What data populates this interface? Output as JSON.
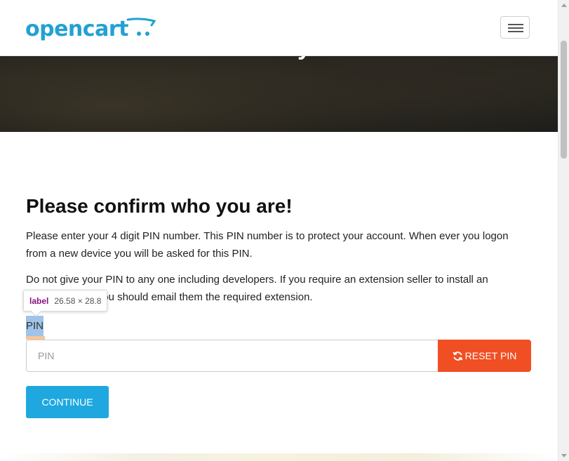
{
  "brand": {
    "logo_text": "opencart",
    "accent_color": "#23a1d1"
  },
  "navbar": {
    "menu_icon": "hamburger-icon"
  },
  "hero": {
    "title": "PIN Security Check"
  },
  "main": {
    "heading": "Please confirm who you are!",
    "paragraph_1": "Please enter your 4 digit PIN number. This PIN number is to protect your account. When ever you logon from a new device you will be asked for this PIN.",
    "paragraph_2": "Do not give your PIN to any one including developers. If you require an extension seller to install an extension then you should email them the required extension."
  },
  "form": {
    "pin_label": "PIN",
    "pin_placeholder": "PIN",
    "pin_value": "",
    "reset_button_label": "RESET PIN",
    "reset_button_icon": "refresh-icon",
    "reset_button_color": "#f04e23",
    "continue_button_label": "CONTINUE",
    "continue_button_color": "#1fa8e0"
  },
  "devtools_tooltip": {
    "tag": "label",
    "dimensions": "26.58 × 28.8"
  }
}
